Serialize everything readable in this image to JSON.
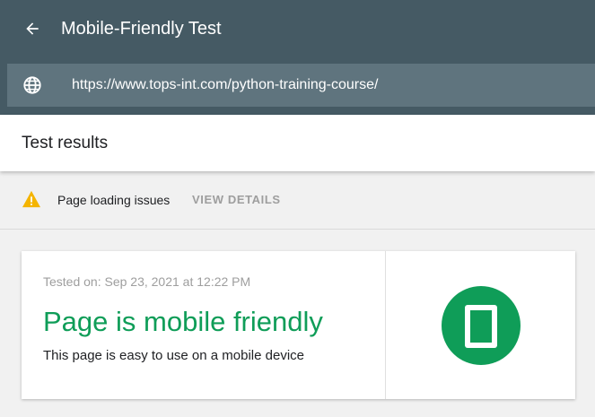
{
  "header": {
    "title": "Mobile-Friendly Test",
    "url": "https://www.tops-int.com/python-training-course/",
    "icons": {
      "back": "arrow-back-icon",
      "globe": "globe-icon"
    },
    "colors": {
      "bar": "#455a64",
      "url_bar": "#5f747e"
    }
  },
  "results": {
    "heading": "Test results"
  },
  "issues": {
    "text": "Page loading issues",
    "action": "VIEW DETAILS",
    "icon": "warning-icon",
    "icon_color": "#f4b400"
  },
  "card": {
    "tested_on": "Tested on: Sep 23, 2021 at 12:22 PM",
    "verdict": "Page is mobile friendly",
    "description": "This page is easy to use on a mobile device",
    "icon": "mobile-phone-icon",
    "accent": "#0f9d58"
  }
}
